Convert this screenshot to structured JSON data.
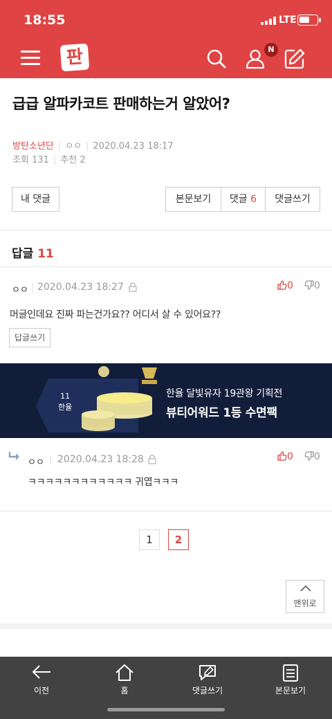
{
  "status": {
    "time": "18:55",
    "network": "LTE"
  },
  "header": {
    "logo": "판",
    "notification_badge": "N"
  },
  "post": {
    "title": "급급 알파카코트 판매하는거 알았어?",
    "category": "방탄소년단",
    "author": "ㅇㅇ",
    "date": "2020.04.23 18:17",
    "views_label": "조회",
    "views": "131",
    "recommend_label": "추천",
    "recommend": "2"
  },
  "toolbar": {
    "my_comments": "내 댓글",
    "view_post": "본문보기",
    "comments_label": "댓글",
    "comments_count": "6",
    "write_comment": "댓글쓰기"
  },
  "replies": {
    "header_label": "답글",
    "count": "11",
    "items": [
      {
        "author": "ㅇㅇ",
        "date": "2020.04.23 18:27",
        "text": "머글인데요 진짜 파는건가요?? 어디서 살 수 있어요??",
        "up": "0",
        "down": "0",
        "reply_btn": "답글쓰기"
      },
      {
        "author": "ㅇㅇ",
        "date": "2020.04.23 18:28",
        "text": "ㅋㅋㅋㅋㅋㅋㅋㅋㅋㅋㅋㅋ 귀엽ㅋㅋㅋ",
        "up": "0",
        "down": "0"
      }
    ]
  },
  "banner": {
    "brand_top": "11",
    "brand_bottom": "한율",
    "line1": "한율 달빛유자 19관왕 기획전",
    "line2": "뷰티어워드 1등 수면팩"
  },
  "pagination": {
    "pages": [
      "1",
      "2"
    ],
    "current": "2"
  },
  "to_top": {
    "label": "맨위로"
  },
  "bottom_nav": {
    "back": "이전",
    "home": "홈",
    "write_comment": "댓글쓰기",
    "view_post": "본문보기"
  },
  "colors": {
    "brand_red": "#e04343",
    "banner_bg": "#121d3a",
    "bottom_bar": "#424242"
  }
}
